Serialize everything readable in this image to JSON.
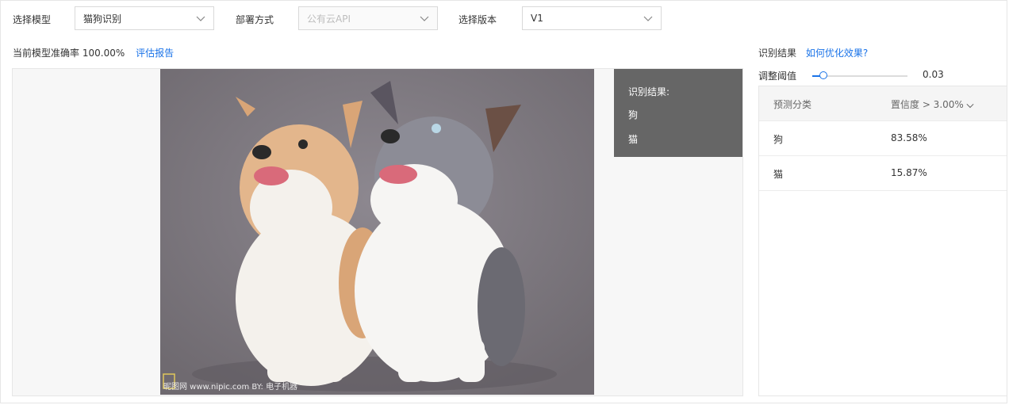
{
  "toolbar": {
    "model_label": "选择模型",
    "model_value": "猫狗识别",
    "deploy_label": "部署方式",
    "deploy_value": "公有云API",
    "version_label": "选择版本",
    "version_value": "V1"
  },
  "accuracy": {
    "label": "当前模型准确率",
    "value": "100.00%",
    "report_link": "评估报告"
  },
  "image": {
    "watermark": "昵图网 www.nipic.com  BY: 电子机器"
  },
  "overlay": {
    "title": "识别结果:",
    "items": [
      "狗",
      "猫"
    ]
  },
  "results": {
    "title": "识别结果",
    "optimize_link": "如何优化效果?",
    "threshold_label": "调整阈值",
    "threshold_value": "0.03",
    "threshold_fraction": 0.03,
    "col_class": "预测分类",
    "col_confidence": "置信度 > 3.00%",
    "rows": [
      {
        "label": "狗",
        "confidence": "83.58%"
      },
      {
        "label": "猫",
        "confidence": "15.87%"
      }
    ]
  },
  "colors": {
    "accent": "#1a73e8",
    "overlay_bg": "#666666"
  }
}
